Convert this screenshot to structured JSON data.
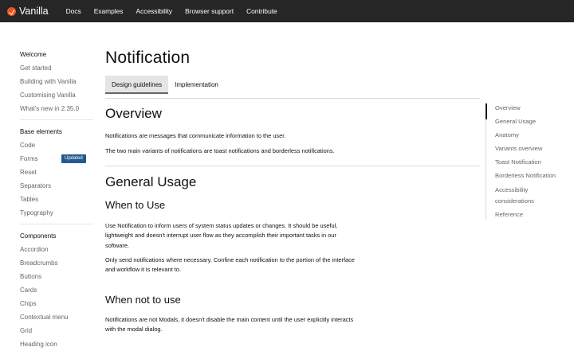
{
  "header": {
    "brand": "Vanilla",
    "nav": [
      "Docs",
      "Examples",
      "Accessibility",
      "Browser support",
      "Contribute"
    ]
  },
  "sidebar": {
    "groups": [
      {
        "heading": "Welcome",
        "items": [
          "Get started",
          "Building with Vanilla",
          "Customising Vanilla",
          "What's new in 2.35.0"
        ]
      },
      {
        "heading": "Base elements",
        "items": [
          "Code",
          "Forms",
          "Reset",
          "Separators",
          "Tables",
          "Typography"
        ]
      },
      {
        "heading": "Components",
        "items": [
          "Accordion",
          "Breadcrumbs",
          "Buttons",
          "Cards",
          "Chips",
          "Contextual menu",
          "Grid",
          "Heading icon"
        ]
      }
    ],
    "badge": "Updated"
  },
  "main": {
    "title": "Notification",
    "tabs": [
      "Design guidelines",
      "Implementation"
    ],
    "overview": {
      "heading": "Overview",
      "p1": "Notifications are messages that communicate information to the user.",
      "p2": "The two main variants of notifications are toast notifications and borderless notifications."
    },
    "usage": {
      "heading": "General Usage",
      "when_heading": "When to Use",
      "when_p1": "Use Notification to inform users of system status updates or changes. It should be useful, lightweight and doesn't interrupt user flow as they accomplish their important tasks in our software.",
      "when_p2": "Only send notifications where necessary. Confine each notification to the portion of the interface and workflow it is relevant to.",
      "not_heading": "When not to use",
      "not_p1": "Notifications are not Modals, it doesn't disable the main content until the user explicitly interacts with the modal dialog."
    }
  },
  "toc": {
    "items": [
      "Overview",
      "General Usage",
      "Anatomy",
      "Variants overview",
      "Toast Notification",
      "Borderless Notification",
      "Accessibility considerations",
      "Reference"
    ]
  },
  "colors": {
    "topbar": "#262626",
    "logo": "#e95420",
    "badge": "#24598f",
    "muted_text": "#666666"
  }
}
